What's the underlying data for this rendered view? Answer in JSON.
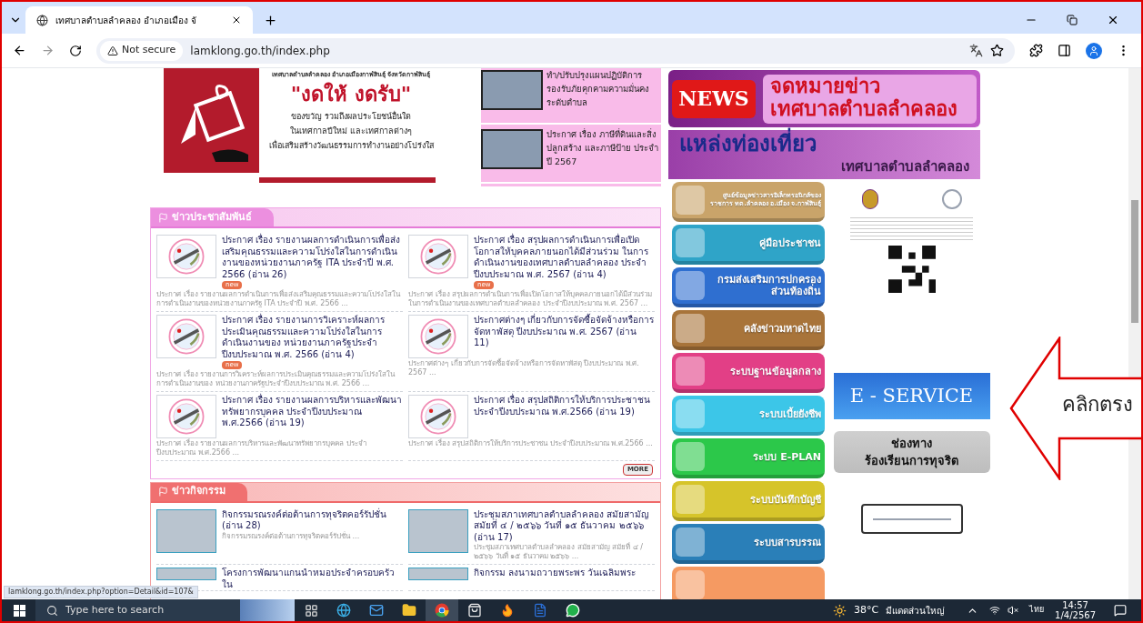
{
  "browser": {
    "tabs": [
      {
        "title": "เทศบาลตำบลลำคลอง อำเภอเมือง จั",
        "selected": true
      }
    ],
    "security": "Not secure",
    "url": "lamklong.go.th/index.php",
    "status_link": "lamklong.go.th/index.php?option=Detail&id=107&"
  },
  "gift_banner": {
    "header": "เทศบาลตำบลลำคลอง อำเภอเมืองกาฬสินธุ์ จังหวัดกาฬสินธุ์",
    "slogan": "\"งดให้ งดรับ\"",
    "lines": [
      "ของขวัญ รวมถึงผลประโยชน์อื่นใด",
      "ในเทศกาลปีใหม่ และเทศกาลต่างๆ",
      "เพื่อเสริมสร้างวัฒนธรรมการทำงานอย่างโปร่งใส"
    ]
  },
  "side_news": [
    {
      "title": "ทำ/ปรับปรุงแผนปฏิบัติการรองรับภัยคุกคามความมั่นคงระดับตำบล"
    },
    {
      "title": "ประกาศ เรื่อง ภาษีที่ดินและสิ่งปลูกสร้าง และภาษีป้าย ประจำปี 2567"
    }
  ],
  "pr_news": {
    "title": "ข่าวประชาสัมพันธ์",
    "more": "MORE",
    "items": [
      {
        "title": "ประกาศ เรื่อง รายงานผลการดำเนินการเพื่อส่งเสริมคุณธรรมและความโปร่งใสในการดำเนินงานของหน่วยงานภาครัฐ ITA ประจำปี พ.ศ. 2566 (อ่าน 26)",
        "is_new": true,
        "badge": "new",
        "summary": "ประกาศ เรื่อง รายงานผลการดำเนินการเพื่อส่งเสริมคุณธรรมและความโปร่งใสในการดำเนินงานของหน่วยงานภาครัฐ ITA ประจำปี พ.ศ. 2566 ..."
      },
      {
        "title": "ประกาศ เรื่อง สรุปผลการดำเนินการเพื่อเปิดโอกาสให้บุคคลภายนอกได้มีส่วนร่วม ในการดำเนินงานของเทศบาลตำบลลำคลอง ประจำปีงบประมาณ พ.ศ. 2567 (อ่าน 4)",
        "is_new": true,
        "badge": "new",
        "summary": "ประกาศ เรื่อง สรุปผลการดำเนินการเพื่อเปิดโอกาสให้บุคคลภายนอกได้มีส่วนร่วม ในการดำเนินงานของเทศบาลตำบลลำคลอง ประจำปีงบประมาณ พ.ศ. 2567 ..."
      },
      {
        "title": "ประกาศ เรื่อง รายงานการวิเคราะห์ผลการประเมินคุณธรรมและความโปร่งใสในการดำเนินงานของ หน่วยงานภาครัฐประจำปีงบประมาณ พ.ศ. 2566 (อ่าน 4)",
        "is_new": true,
        "badge": "new",
        "summary": "ประกาศ เรื่อง รายงานการวิเคราะห์ผลการประเมินคุณธรรมและความโปร่งใสในการดำเนินงานของ หน่วยงานภาครัฐประจำปีงบประมาณ พ.ศ. 2566 ..."
      },
      {
        "title": "ประกาศต่างๆ เกี่ยวกับการจัดซื้อจัดจ้างหรือการจัดหาพัสดุ ปีงบประมาณ พ.ศ. 2567 (อ่าน 11)",
        "is_new": false,
        "summary": "ประกาศต่างๆ เกี่ยวกับการจัดซื้อจัดจ้างหรือการจัดหาพัสดุ ปีงบประมาณ พ.ศ. 2567 ..."
      },
      {
        "title": "ประกาศ เรื่อง รายงานผลการบริหารและพัฒนาทรัพยากรบุคคล ประจำปีงบประมาณ พ.ศ.2566 (อ่าน 19)",
        "is_new": false,
        "summary": "ประกาศ เรื่อง รายงานผลการบริหารและพัฒนาทรัพยากรบุคคล ประจำปีงบประมาณ พ.ศ.2566 ..."
      },
      {
        "title": "ประกาศ เรื่อง สรุปสถิติการให้บริการประชาชน ประจำปีงบประมาณ พ.ศ.2566 (อ่าน 19)",
        "is_new": false,
        "summary": "ประกาศ เรื่อง สรุปสถิติการให้บริการประชาชน ประจำปีงบประมาณ พ.ศ.2566 ..."
      }
    ]
  },
  "activities": {
    "title": "ข่าวกิจกรรม",
    "items": [
      {
        "title": "กิจกรรมรณรงค์ต่อต้านการทุจริตคอร์รัปชั่น (อ่าน 28)",
        "summary": "กิจกรรมรณรงค์ต่อต้านการทุจริตคอร์รัปชั่น ..."
      },
      {
        "title": "ประชุมสภาเทศบาลตำบลลำคลอง สมัยสามัญ สมัยที่ ๔ / ๒๕๖๖ วันที่ ๑๕ ธันวาคม ๒๕๖๖ (อ่าน 17)",
        "summary": "ประชุมสภาเทศบาลตำบลลำคลอง สมัยสามัญ สมัยที่ ๔ / ๒๕๖๖ วันที่ ๑๕ ธันวาคม ๒๕๖๖ ..."
      },
      {
        "title": "โครงการพัฒนาแกนนำหมอประจำครอบครัวใน"
      },
      {
        "title": "กิจกรรม ลงนามถวายพระพร วันเฉลิมพระ"
      }
    ]
  },
  "news_banner": {
    "badge": "NEWS",
    "line1": "จดหมายข่าว",
    "line2": "เทศบาลตำบลลำคลอง"
  },
  "tourism_banner": {
    "line1": "แหล่งท่องเที่ยว",
    "line2": "เทศบาลตำบลลำคลอง"
  },
  "menu": [
    {
      "label": "ศูนย์ข้อมูลข่าวสารอิเล็กทรอนิกส์ของราชการ ทต.ลำคลอง อ.เมือง จ.กาฬสินธุ์",
      "color": "#c9a46a"
    },
    {
      "label": "คู่มือประชาชน",
      "color": "#2fa4c8"
    },
    {
      "label": "กรมส่งเสริมการปกครองส่วนท้องถิ่น",
      "color": "#2f6fd0"
    },
    {
      "label": "คลังข่าวมหาดไทย",
      "color": "#a8743a"
    },
    {
      "label": "ระบบฐานข้อมูลกลาง",
      "color": "#e23f86"
    },
    {
      "label": "ระบบเบี้ยยังชีพ",
      "color": "#3cc6e8"
    },
    {
      "label": "ระบบ  E-PLAN",
      "color": "#2cc84a"
    },
    {
      "label": "ระบบบันทึกบัญชี",
      "color": "#d6c42a"
    },
    {
      "label": "ระบบสารบรรณ",
      "color": "#2a7fb8"
    },
    {
      "color": "#f59a62"
    }
  ],
  "eservice": {
    "label": "E - SERVICE"
  },
  "complaint": {
    "line1": "ช่องทาง",
    "line2": "ร้องเรียนการทุจริต"
  },
  "callout": {
    "text": "คลิกตรง"
  },
  "taskbar": {
    "search_placeholder": "Type here to search",
    "apps": [
      {
        "kind": "taskview",
        "active": false
      },
      {
        "kind": "edge",
        "active": false
      },
      {
        "kind": "mail",
        "active": false
      },
      {
        "kind": "folder",
        "active": false
      },
      {
        "kind": "chrome",
        "active": true
      },
      {
        "kind": "store",
        "active": false
      },
      {
        "kind": "firefox",
        "active": false
      },
      {
        "kind": "word",
        "active": false
      },
      {
        "kind": "line",
        "active": false
      }
    ],
    "weather": "38°C",
    "weather_text": "มีแดดส่วนใหญ่",
    "language": "ไทย",
    "time": "14:57",
    "date": "1/4/2567"
  }
}
